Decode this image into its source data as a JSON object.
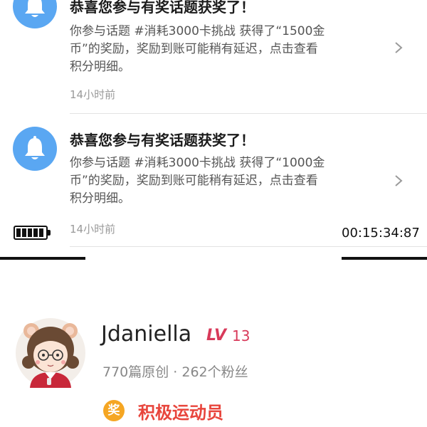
{
  "notifications": [
    {
      "title": "恭喜您参与有奖话题获奖了！",
      "line1": "你参与话题 #消耗3000卡挑战 获得了“1500金",
      "line2": "币”的奖励，奖励到账可能稍有延迟，点击查看",
      "line3": "积分明细。",
      "time": "14小时前"
    },
    {
      "title": "恭喜您参与有奖话题获奖了！",
      "line1": "你参与话题 #消耗3000卡挑战 获得了“1000金",
      "line2": "币”的奖励，奖励到账可能稍有延迟，点击查看",
      "line3": "积分明细。",
      "time": "14小时前"
    }
  ],
  "recorder": {
    "timecode": "00:15:34:87"
  },
  "profile": {
    "username": "Jdaniella",
    "level_prefix": "LV",
    "level": "13",
    "stats": "770篇原创 · 262个粉丝",
    "badge_icon_text": "奖",
    "badge_label": "积极运动员"
  },
  "colors": {
    "bell_bg": "#5aa7f2",
    "level": "#d83a5a",
    "badge_icon": "#f5a623",
    "badge_text": "#e8453c"
  }
}
